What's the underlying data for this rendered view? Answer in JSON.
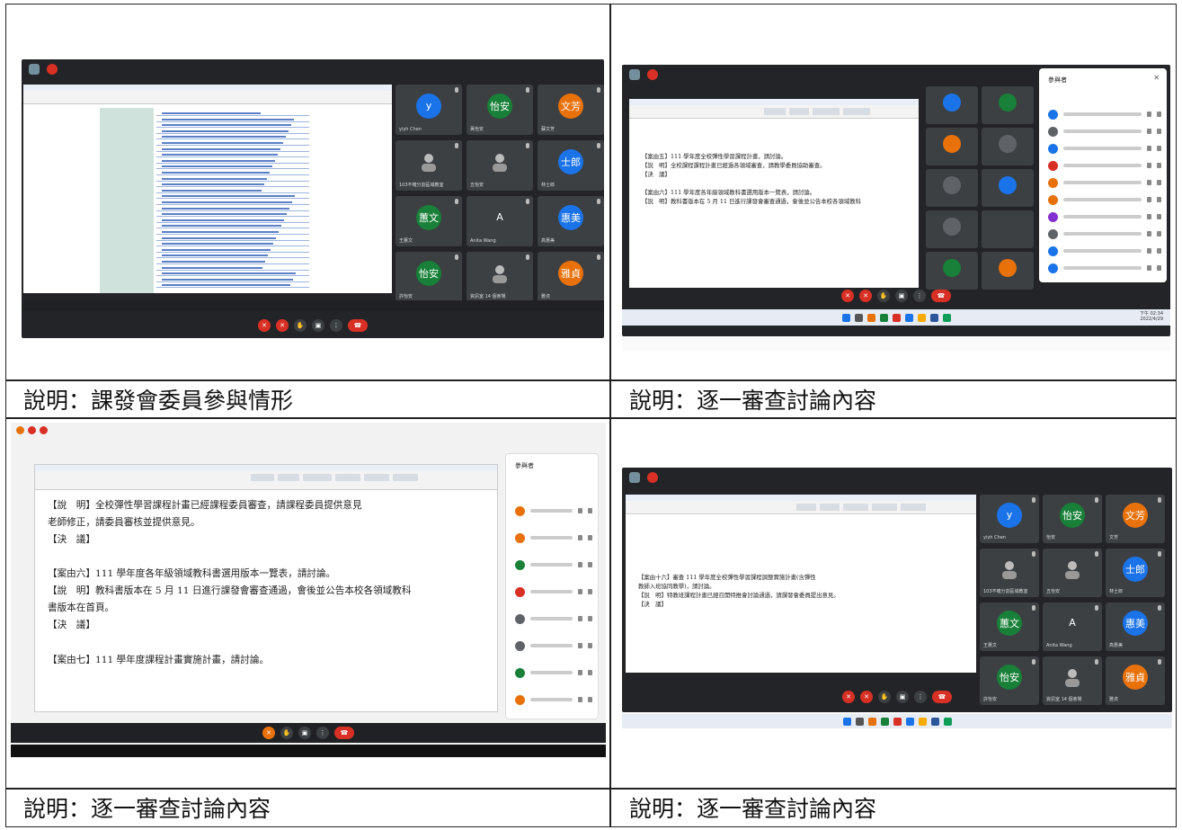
{
  "captions": [
    {
      "label": "說明：課發會委員參與情形"
    },
    {
      "label": "說明：逐一審查討論內容"
    },
    {
      "label": "說明：逐一審查討論內容"
    },
    {
      "label": "說明：逐一審查討論內容"
    }
  ],
  "screens": {
    "s1": {
      "participants": [
        {
          "initial": "y",
          "name": "yiyh Chen",
          "color": "#1a73e8"
        },
        {
          "initial": "怡安",
          "name": "黃怡安",
          "color": "#188038"
        },
        {
          "initial": "文芳",
          "name": "蘇文芳",
          "color": "#e8710a"
        },
        {
          "initial": "",
          "name": "103不確分割區域教室",
          "color": "#5f6368"
        },
        {
          "initial": "",
          "name": "五怡安",
          "color": "#5f6368"
        },
        {
          "initial": "士郎",
          "name": "林士郎",
          "color": "#1a73e8"
        },
        {
          "initial": "蕙文",
          "name": "王蕙文",
          "color": "#188038"
        },
        {
          "initial": "A",
          "name": "Anita Wang",
          "color": "#3c4043"
        },
        {
          "initial": "惠美",
          "name": "高惠美",
          "color": "#1a73e8"
        },
        {
          "initial": "怡安",
          "name": "許怡安",
          "color": "#188038"
        },
        {
          "initial": "",
          "name": "資訊室 14 個會場",
          "color": "#8430ce"
        },
        {
          "initial": "雅貞",
          "name": "雅貞",
          "color": "#e8710a"
        }
      ]
    },
    "s2": {
      "panel_title": "參與者",
      "doc_lines": [
        "【案由五】111 學年度全校彈性學習課程計畫，請討論。",
        "【說　明】全校課程課程計畫已經過各領域審查，請教學委員協助審查。",
        "【決　議】",
        "",
        "【案由六】111 學年度各年級領域教科書選用版本一覽表，請討論。",
        "【說　明】教科書版本在 5 月 11 日進行課發會審查通過，會後並公告本校各領域教科"
      ],
      "clock": "下午 02:34",
      "date": "2022/4/29"
    },
    "s3": {
      "panel_title": "參與者",
      "doc_lines": [
        "【說　明】全校彈性學習課程計畫已經課程委員審查，請課程委員提供意見",
        "老師修正，請委員審核並提供意見。",
        "【決　議】",
        "",
        "【案由六】111 學年度各年級領域教科書選用版本一覽表，請討論。",
        "【說　明】教科書版本在 5 月 11 日進行課發會審查通過，會後並公告本校各領域教科",
        "書版本在首頁。",
        "【決　議】",
        "",
        "【案由七】111 學年度課程計畫實施計畫，請討論。"
      ]
    },
    "s4": {
      "doc_lines": [
        "【案由十六】審查 111 學年度全校彈性學習課程調整實施計畫(含彈性",
        "教師入班協同教學)，請討論。",
        "【說　明】特教班課程計畫已經召開特推會討論通過，請課發會委員提出意見。",
        "【決　議】"
      ],
      "participants": [
        {
          "initial": "y",
          "name": "yiyh Chen",
          "color": "#1a73e8"
        },
        {
          "initial": "怡安",
          "name": "怡安",
          "color": "#188038"
        },
        {
          "initial": "文芳",
          "name": "文芳",
          "color": "#e8710a"
        },
        {
          "initial": "",
          "name": "103不確分割區域教室",
          "color": "#5f6368"
        },
        {
          "initial": "",
          "name": "五怡安",
          "color": "#5f6368"
        },
        {
          "initial": "士郎",
          "name": "林士郎",
          "color": "#1a73e8"
        },
        {
          "initial": "蕙文",
          "name": "王蕙文",
          "color": "#188038"
        },
        {
          "initial": "A",
          "name": "Anita Wang",
          "color": "#3c4043"
        },
        {
          "initial": "惠美",
          "name": "高惠美",
          "color": "#1a73e8"
        },
        {
          "initial": "怡安",
          "name": "許怡安",
          "color": "#188038"
        },
        {
          "initial": "",
          "name": "資訊室 14 個會場",
          "color": "#8430ce"
        },
        {
          "initial": "雅貞",
          "name": "雅貞",
          "color": "#e8710a"
        }
      ]
    }
  }
}
